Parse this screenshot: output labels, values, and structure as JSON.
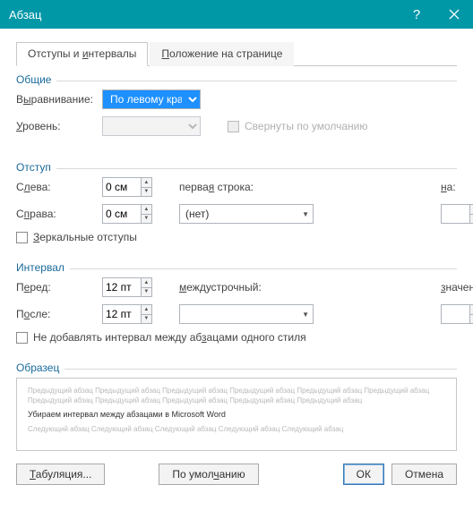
{
  "title": "Абзац",
  "tabs": {
    "intervals": "Отступы и интервалы",
    "position": "Положение на странице"
  },
  "underline": {
    "intervals_char": "и",
    "position_char": "П"
  },
  "groups": {
    "general": "Общие",
    "indent": "Отступ",
    "spacing": "Интервал",
    "preview": "Образец"
  },
  "general": {
    "align_label": "Выравнивание:",
    "align_value": "По левому краю",
    "level_label": "Уровень:",
    "level_value": "",
    "collapse_label": "Свернуты по умолчанию"
  },
  "indent": {
    "left_label": "Слева:",
    "left_value": "0 см",
    "right_label": "Справа:",
    "right_value": "0 см",
    "special_label": "первая строка:",
    "special_value": "(нет)",
    "by_label": "на:",
    "by_value": "",
    "mirror_label": "Зеркальные отступы"
  },
  "spacing": {
    "before_label": "Перед:",
    "before_value": "12 пт",
    "after_label": "После:",
    "after_value": "12 пт",
    "line_label": "междустрочный:",
    "line_value": "",
    "at_label": "значение:",
    "at_value": "",
    "nospace_label": "Не добавлять интервал между абзацами одного стиля"
  },
  "preview": {
    "before": "Предыдущий абзац Предыдущий абзац Предыдущий абзац Предыдущий абзац Предыдущий абзац Предыдущий абзац Предыдущий абзац Предыдущий абзац Предыдущий абзац Предыдущий абзац Предыдущий абзац",
    "main": "Убираем интервал между абзацами в Microsoft Word",
    "after": "Следующий абзац Следующий абзац Следующий абзац Следующий абзац Следующий абзац"
  },
  "buttons": {
    "tabs": "Табуляция...",
    "defaults": "По умолчанию",
    "ok": "ОК",
    "cancel": "Отмена"
  }
}
